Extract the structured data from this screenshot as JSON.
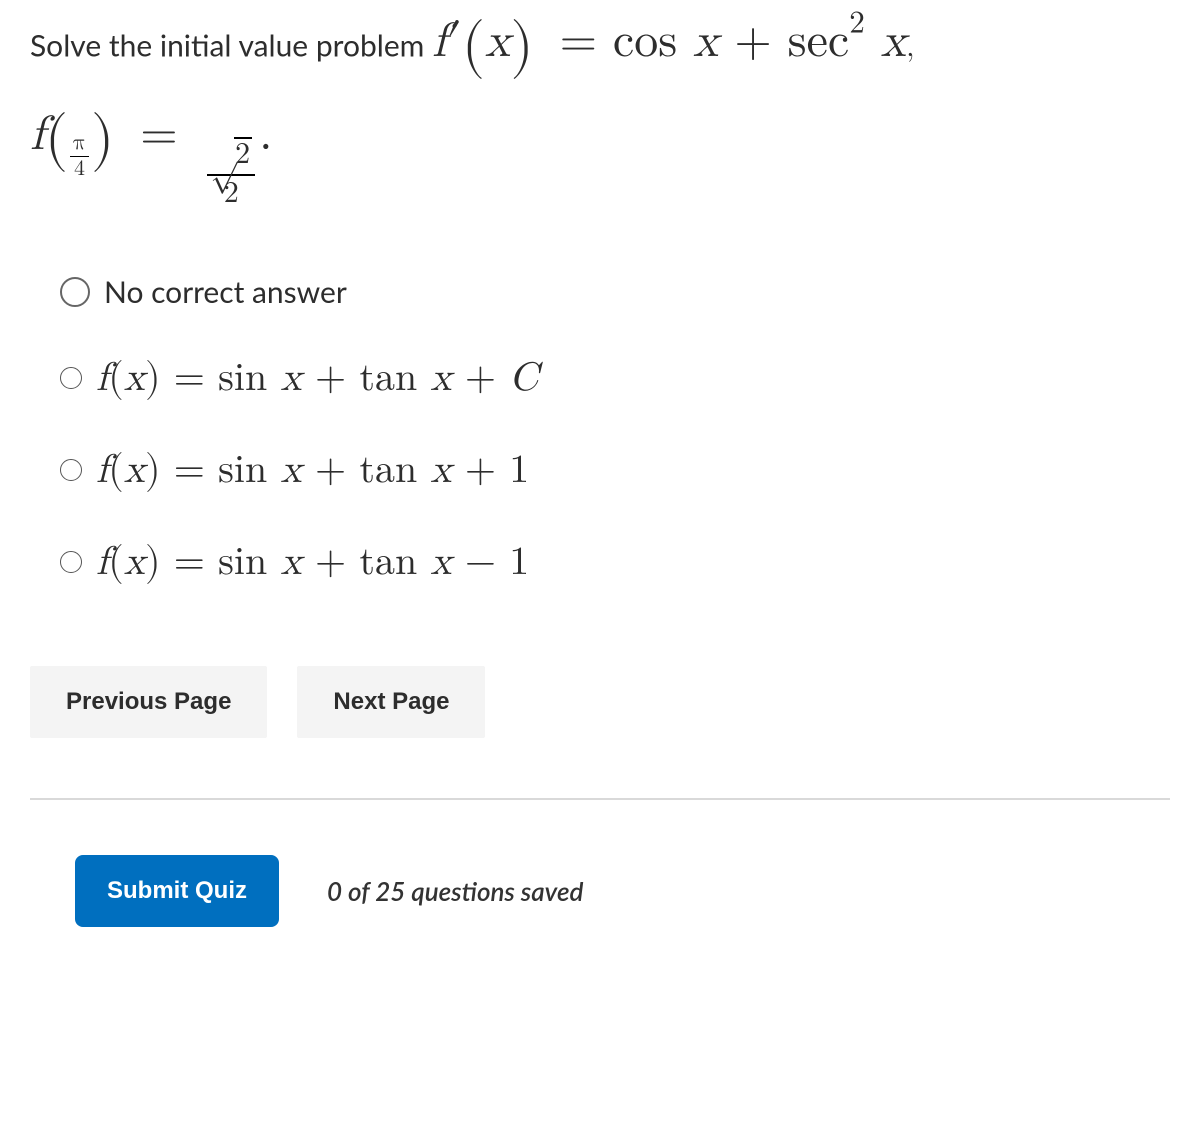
{
  "question": {
    "prefix": "Solve the initial value problem",
    "equation_fprime": "f′(x) = cos x + sec² x",
    "equation_initial": "f(π/4) = √2 / 2"
  },
  "options": [
    {
      "text": "No correct answer",
      "math": false
    },
    {
      "text": "f(x) = sin x + tan x + C",
      "math": true
    },
    {
      "text": "f(x) = sin x + tan x + 1",
      "math": true
    },
    {
      "text": "f(x) = sin x + tan x − 1",
      "math": true
    }
  ],
  "nav": {
    "prev": "Previous Page",
    "next": "Next Page"
  },
  "footer": {
    "submit": "Submit Quiz",
    "saved": "0 of 25 questions saved"
  }
}
